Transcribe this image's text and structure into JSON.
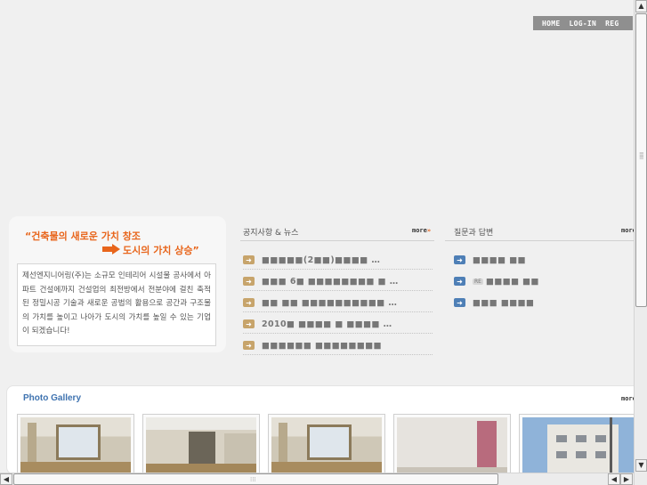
{
  "nav": {
    "items": [
      "HOME",
      "LOG-IN",
      "REG"
    ]
  },
  "intro": {
    "slogan_line1": "“건축물의 새로운 가치 창조",
    "slogan_line2": "도시의 가치 상승”",
    "description": "제선엔지니어링(주)는 소규모 인테리어 시설물 공사에서 아파트 건설에까지 건설업의 최전방에서 전분야에 걸친 축적된 정밀시공 기술과 새로운 공법의 활용으로 공간과 구조물의 가치를 높이고 나아가 도시의 가치를 높일 수 있는 기업이 되겠습니다!"
  },
  "news": {
    "title": "공지사항 & 뉴스",
    "more": "more",
    "items": [
      "■■■■■(2■■)■■■■ …",
      "■■■ 6■ ■■■■■■■■ ■ …",
      "■■ ■■ ■■■■■■■■■■ …",
      "2010■ ■■■■ ■ ■■■■ …",
      "■■■■■■ ■■■■■■■■"
    ]
  },
  "qna": {
    "title": "질문과 답변",
    "more": "more",
    "re_label": "RE",
    "items": [
      "■■■■ ■■",
      "■■■■ ■■",
      "■■■ ■■■■"
    ]
  },
  "gallery": {
    "title": "Photo Gallery",
    "more": "more"
  },
  "colors": {
    "accent": "#e8651b",
    "nav_bg": "#8f8f8f",
    "gallery_title": "#3f73b0",
    "bullet_news": "#c7a46b",
    "bullet_qna": "#4e7fb6"
  }
}
